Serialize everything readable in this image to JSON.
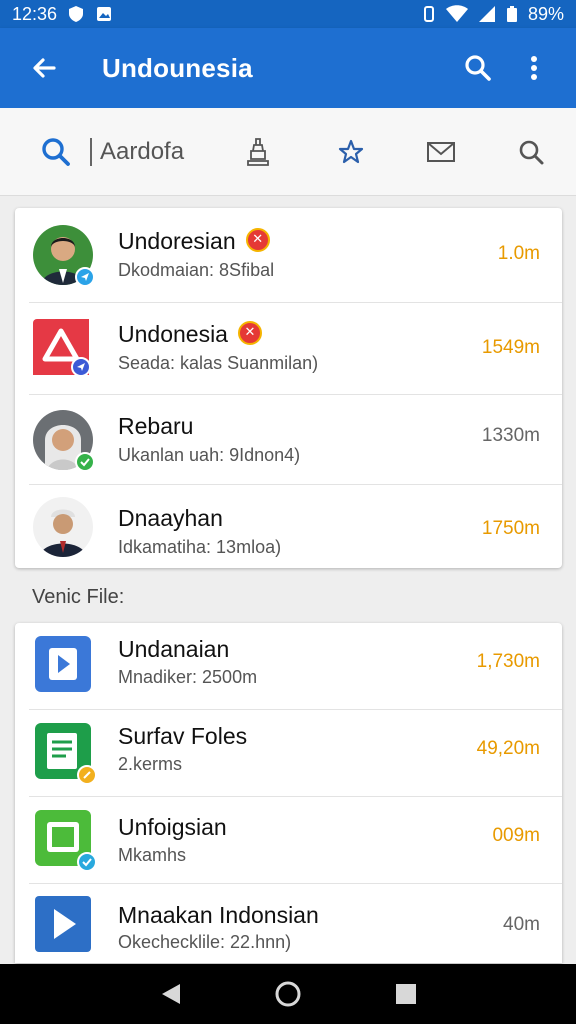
{
  "status": {
    "time": "12:36",
    "battery": "89%"
  },
  "appbar": {
    "title": "Undounesia",
    "back_icon": "arrow-left-icon",
    "search_icon": "search-icon",
    "menu_icon": "more-vert-icon"
  },
  "tabs": {
    "search_query": "Aardofa",
    "items": [
      {
        "icon": "search-icon"
      },
      {
        "icon": "monument-icon"
      },
      {
        "icon": "star-icon"
      },
      {
        "icon": "mail-icon"
      },
      {
        "icon": "search-outline-icon"
      }
    ],
    "active_index": 1
  },
  "people": [
    {
      "name": "Undoresian",
      "sub": "Dkodmaian: 8Sfibal",
      "value": "1.0m",
      "value_color": "#e89a00",
      "flag": true,
      "badge_color": "#2ba3e8"
    },
    {
      "name": "Undonesia",
      "sub": "Seada: kalas Suanmilan)",
      "value": "1549m",
      "value_color": "#e89a00",
      "flag": true,
      "badge_color": "#3d5ad6"
    },
    {
      "name": "Rebaru",
      "sub": "Ukanlan uah: 9Idnon4)",
      "value": "1330m",
      "value_color": "#666666",
      "flag": false,
      "badge_color": "#35b24a"
    },
    {
      "name": "Dnaayhan",
      "sub": "Idkamatiha: 13mloa)",
      "value": "1750m",
      "value_color": "#e89a00",
      "flag": false,
      "badge_color": null
    }
  ],
  "section_label": "Venic File:",
  "files": [
    {
      "name": "Undanaian",
      "sub": "Mnadiker: 2500m",
      "value": "1,730m",
      "value_color": "#e89a00",
      "icon": "play-file-icon",
      "icon_color": "#3b78d8"
    },
    {
      "name": "Surfav Foles",
      "sub": "2.kerms",
      "value": "49,20m",
      "value_color": "#e89a00",
      "icon": "document-icon",
      "icon_color": "#1e9e4a"
    },
    {
      "name": "Unfoigsian",
      "sub": "Mkamhs",
      "value": "009m",
      "value_color": "#e89a00",
      "icon": "frame-icon",
      "icon_color": "#4cbb3a"
    },
    {
      "name": "Mnaakan Indonsian",
      "sub": "Okechecklile: 22.hnn)",
      "value": "40m",
      "value_color": "#666666",
      "icon": "play-icon",
      "icon_color": "#2d6fc6"
    }
  ],
  "nav": {
    "back": "back-triangle-icon",
    "home": "home-circle-icon",
    "recents": "recents-square-icon"
  }
}
